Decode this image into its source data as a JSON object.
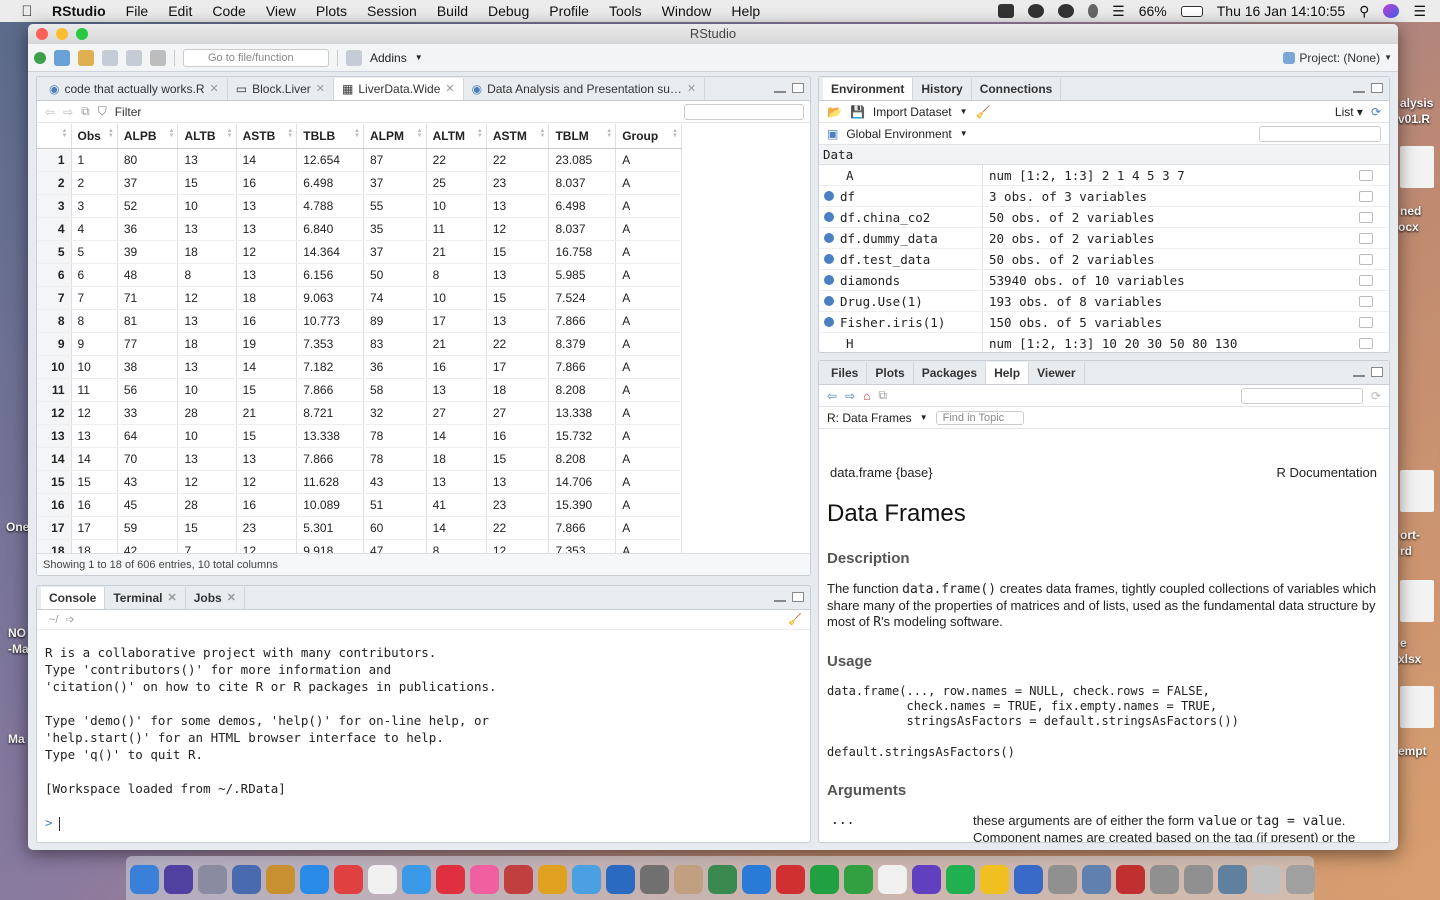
{
  "menubar": {
    "app": "RStudio",
    "items": [
      "File",
      "Edit",
      "Code",
      "View",
      "Plots",
      "Session",
      "Build",
      "Debug",
      "Profile",
      "Tools",
      "Window",
      "Help"
    ],
    "battery": "66%",
    "clock": "Thu 16 Jan  14:10:55"
  },
  "desktop": {
    "labels_right": [
      "alysis",
      "v01.R",
      "ned",
      "ocx",
      "ort-",
      "rd",
      "e",
      "xlsx",
      "empt"
    ],
    "labels_left": [
      "One",
      "NO",
      "-Ma",
      "Ma"
    ]
  },
  "window": {
    "title": "RStudio"
  },
  "toolbar": {
    "goto_placeholder": "Go to file/function",
    "addins": "Addins",
    "project": "Project: (None)"
  },
  "editor": {
    "tabs": [
      "code that actually works.R",
      "Block.Liver",
      "LiverData.Wide",
      "Data Analysis and Presentation su…"
    ],
    "filter": "Filter",
    "columns": [
      "Obs",
      "ALPB",
      "ALTB",
      "ASTB",
      "TBLB",
      "ALPM",
      "ALTM",
      "ASTM",
      "TBLM",
      "Group"
    ],
    "rows": [
      [
        "1",
        "1",
        "80",
        "13",
        "14",
        "12.654",
        "87",
        "22",
        "22",
        "23.085",
        "A"
      ],
      [
        "2",
        "2",
        "37",
        "15",
        "16",
        "6.498",
        "37",
        "25",
        "23",
        "8.037",
        "A"
      ],
      [
        "3",
        "3",
        "52",
        "10",
        "13",
        "4.788",
        "55",
        "10",
        "13",
        "6.498",
        "A"
      ],
      [
        "4",
        "4",
        "36",
        "13",
        "13",
        "6.840",
        "35",
        "11",
        "12",
        "8.037",
        "A"
      ],
      [
        "5",
        "5",
        "39",
        "18",
        "12",
        "14.364",
        "37",
        "21",
        "15",
        "16.758",
        "A"
      ],
      [
        "6",
        "6",
        "48",
        "8",
        "13",
        "6.156",
        "50",
        "8",
        "13",
        "5.985",
        "A"
      ],
      [
        "7",
        "7",
        "71",
        "12",
        "18",
        "9.063",
        "74",
        "10",
        "15",
        "7.524",
        "A"
      ],
      [
        "8",
        "8",
        "81",
        "13",
        "16",
        "10.773",
        "89",
        "17",
        "13",
        "7.866",
        "A"
      ],
      [
        "9",
        "9",
        "77",
        "18",
        "19",
        "7.353",
        "83",
        "21",
        "22",
        "8.379",
        "A"
      ],
      [
        "10",
        "10",
        "38",
        "13",
        "14",
        "7.182",
        "36",
        "16",
        "17",
        "7.866",
        "A"
      ],
      [
        "11",
        "11",
        "56",
        "10",
        "15",
        "7.866",
        "58",
        "13",
        "18",
        "8.208",
        "A"
      ],
      [
        "12",
        "12",
        "33",
        "28",
        "21",
        "8.721",
        "32",
        "27",
        "27",
        "13.338",
        "A"
      ],
      [
        "13",
        "13",
        "64",
        "10",
        "15",
        "13.338",
        "78",
        "14",
        "16",
        "15.732",
        "A"
      ],
      [
        "14",
        "14",
        "70",
        "13",
        "13",
        "7.866",
        "78",
        "18",
        "15",
        "8.208",
        "A"
      ],
      [
        "15",
        "15",
        "43",
        "12",
        "12",
        "11.628",
        "43",
        "13",
        "13",
        "14.706",
        "A"
      ],
      [
        "16",
        "16",
        "45",
        "28",
        "16",
        "10.089",
        "51",
        "41",
        "23",
        "15.390",
        "A"
      ],
      [
        "17",
        "17",
        "59",
        "15",
        "23",
        "5.301",
        "60",
        "14",
        "22",
        "7.866",
        "A"
      ],
      [
        "18",
        "18",
        "42",
        "7",
        "12",
        "9.918",
        "47",
        "8",
        "12",
        "7.353",
        "A"
      ]
    ],
    "status": "Showing 1 to 18 of 606 entries, 10 total columns"
  },
  "console": {
    "tabs": [
      "Console",
      "Terminal",
      "Jobs"
    ],
    "path": "~/",
    "lines": [
      "R is a collaborative project with many contributors.",
      "Type 'contributors()' for more information and",
      "'citation()' on how to cite R or R packages in publications.",
      "",
      "Type 'demo()' for some demos, 'help()' for on-line help, or",
      "'help.start()' for an HTML browser interface to help.",
      "Type 'q()' to quit R.",
      "",
      "[Workspace loaded from ~/.RData]",
      ""
    ],
    "prompt": ">"
  },
  "environment": {
    "tabs": [
      "Environment",
      "History",
      "Connections"
    ],
    "import": "Import Dataset",
    "view_mode": "List",
    "scope": "Global Environment",
    "section": "Data",
    "vars": [
      {
        "name": "A",
        "value": "num [1:2, 1:3] 2 1 4 5 3 7",
        "expandable": false
      },
      {
        "name": "df",
        "value": "3 obs. of 3 variables",
        "expandable": true
      },
      {
        "name": "df.china_co2",
        "value": "50 obs. of 2 variables",
        "expandable": true
      },
      {
        "name": "df.dummy_data",
        "value": "20 obs. of 2 variables",
        "expandable": true
      },
      {
        "name": "df.test_data",
        "value": "50 obs. of 2 variables",
        "expandable": true
      },
      {
        "name": "diamonds",
        "value": "53940 obs. of 10 variables",
        "expandable": true
      },
      {
        "name": "Drug.Use(1)",
        "value": "193 obs. of 8 variables",
        "expandable": true
      },
      {
        "name": "Fisher.iris(1)",
        "value": "150 obs. of 5 variables",
        "expandable": true
      },
      {
        "name": "H",
        "value": "num [1:2, 1:3] 10 20 30 50 80 130",
        "expandable": false
      }
    ]
  },
  "help": {
    "tabs": [
      "Files",
      "Plots",
      "Packages",
      "Help",
      "Viewer"
    ],
    "topic": "R: Data Frames",
    "find_placeholder": "Find in Topic",
    "top_left": "data.frame {base}",
    "top_right": "R Documentation",
    "title": "Data Frames",
    "description_heading": "Description",
    "description_pre": "The function ",
    "description_code": "data.frame()",
    "description_post": " creates data frames, tightly coupled collections of variables which share many of the properties of matrices and of lists, used as the fundamental data structure by most of ",
    "description_r": "R",
    "description_end": "'s modeling software.",
    "usage_heading": "Usage",
    "usage_code": "data.frame(..., row.names = NULL, check.rows = FALSE,\n           check.names = TRUE, fix.empty.names = TRUE,\n           stringsAsFactors = default.stringsAsFactors())",
    "usage_code2": "default.stringsAsFactors()",
    "arguments_heading": "Arguments",
    "arg_name": "...",
    "arg_desc_pre": "these arguments are of either the form ",
    "arg_code1": "value",
    "arg_desc_mid": " or ",
    "arg_code2": "tag = value",
    "arg_desc_post": ". Component names are created based on the tag (if present) or the deparsed argument itself."
  },
  "colors": {
    "accent": "#4a7fc1",
    "close": "#fe5f57",
    "minimize": "#febc2e",
    "zoom": "#28c840"
  }
}
